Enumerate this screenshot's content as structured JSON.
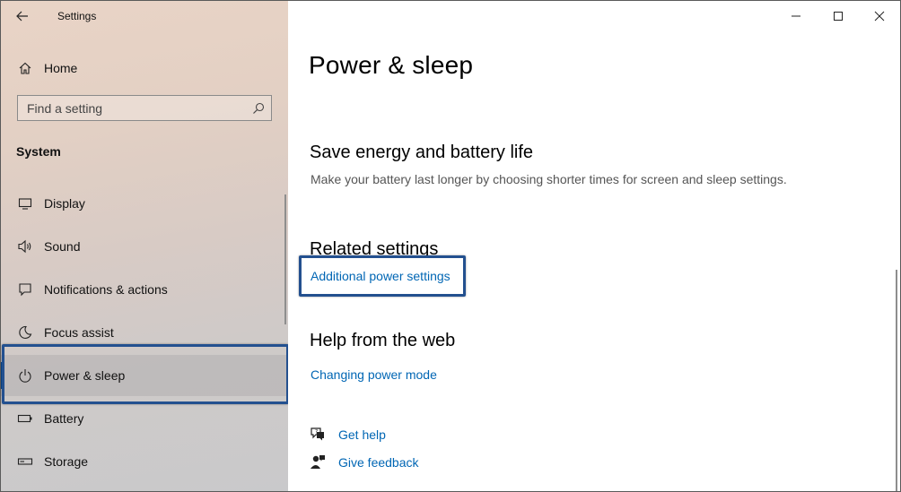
{
  "window": {
    "app_title": "Settings"
  },
  "sidebar": {
    "home_label": "Home",
    "search": {
      "placeholder": "Find a setting",
      "value": ""
    },
    "section_title": "System",
    "items": [
      {
        "label": "Display",
        "icon": "monitor-icon"
      },
      {
        "label": "Sound",
        "icon": "speaker-icon"
      },
      {
        "label": "Notifications & actions",
        "icon": "notification-icon"
      },
      {
        "label": "Focus assist",
        "icon": "moon-icon"
      },
      {
        "label": "Power & sleep",
        "icon": "power-icon",
        "selected": true
      },
      {
        "label": "Battery",
        "icon": "battery-icon"
      },
      {
        "label": "Storage",
        "icon": "storage-icon"
      }
    ]
  },
  "main": {
    "page_title": "Power & sleep",
    "save_energy": {
      "heading": "Save energy and battery life",
      "description": "Make your battery last longer by choosing shorter times for screen and sleep settings."
    },
    "related": {
      "heading": "Related settings",
      "link": "Additional power settings"
    },
    "help_web": {
      "heading": "Help from the web",
      "link": "Changing power mode"
    },
    "get_help": "Get help",
    "give_feedback": "Give feedback"
  },
  "colors": {
    "accent": "#0a4a94",
    "link": "#0066b4",
    "highlight_border": "#23508f"
  }
}
